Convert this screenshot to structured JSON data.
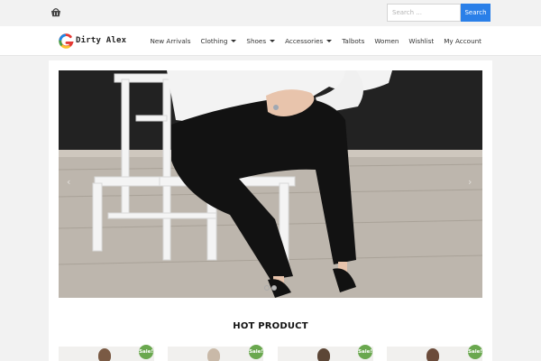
{
  "topbar": {
    "cart_icon": "basket-icon",
    "search": {
      "placeholder": "Search ...",
      "button_label": "Search"
    }
  },
  "brand": {
    "name": "Dirty Alex",
    "logo_icon": "g-logo-icon"
  },
  "nav": {
    "items": [
      {
        "label": "New Arrivals",
        "dropdown": false
      },
      {
        "label": "Clothing",
        "dropdown": true
      },
      {
        "label": "Shoes",
        "dropdown": true
      },
      {
        "label": "Accessories",
        "dropdown": true
      },
      {
        "label": "Talbots",
        "dropdown": false
      },
      {
        "label": "Women",
        "dropdown": false
      },
      {
        "label": "Wishlist",
        "dropdown": false
      },
      {
        "label": "My Account",
        "dropdown": false
      }
    ]
  },
  "slider": {
    "prev_glyph": "‹",
    "next_glyph": "›",
    "slides": 2,
    "active_slide": 2
  },
  "hot_product": {
    "title": "HOT PRODUCT",
    "items": [
      {
        "badge": "Sale!"
      },
      {
        "badge": "Sale!"
      },
      {
        "badge": "Sale!"
      },
      {
        "badge": "Sale!"
      }
    ]
  },
  "colors": {
    "accent": "#2a7fe8",
    "sale_badge": "#6aa84f",
    "page_bg": "#f2f2f2"
  }
}
